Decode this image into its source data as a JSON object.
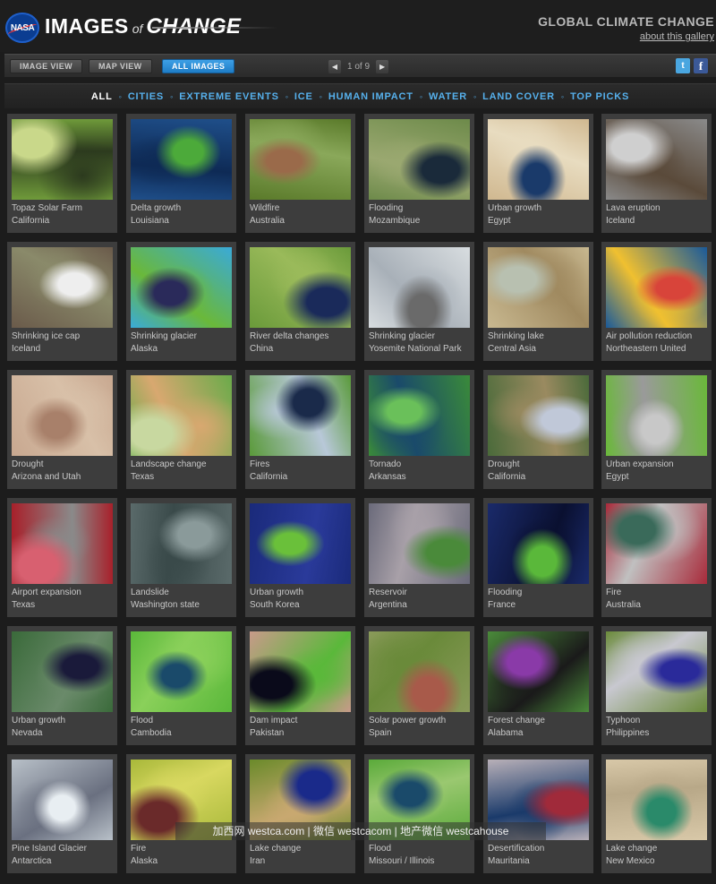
{
  "header": {
    "logo_text": "NASA",
    "brand_part1": "IMAGES",
    "brand_part2": "of",
    "brand_part3": "CHANGE",
    "site_title": "GLOBAL CLIMATE CHANGE",
    "about_link": "about this gallery"
  },
  "toolbar": {
    "image_view": "IMAGE VIEW",
    "map_view": "MAP VIEW",
    "all_images": "ALL IMAGES",
    "page_indicator": "1 of 9",
    "prev_icon": "chevron-left-icon",
    "next_icon": "chevron-right-icon",
    "twitter_icon": "twitter-icon",
    "facebook_icon": "facebook-icon",
    "facebook_glyph": "f",
    "twitter_glyph": "t"
  },
  "categories": [
    "ALL",
    "CITIES",
    "EXTREME EVENTS",
    "ICE",
    "HUMAN IMPACT",
    "WATER",
    "LAND COVER",
    "TOP PICKS"
  ],
  "tiles": [
    {
      "title": "Topaz Solar Farm",
      "location": "California",
      "colors": [
        "#6f9a3a",
        "#c9d88a",
        "#2c3a1e"
      ]
    },
    {
      "title": "Delta growth",
      "location": "Louisiana",
      "colors": [
        "#1f4f8a",
        "#4caa3a",
        "#0e2a55"
      ]
    },
    {
      "title": "Wildfire",
      "location": "Australia",
      "colors": [
        "#5a7a2a",
        "#9a6a4a",
        "#8aa85a"
      ]
    },
    {
      "title": "Flooding",
      "location": "Mozambique",
      "colors": [
        "#6d8a4a",
        "#1a2a3a",
        "#9aa870"
      ]
    },
    {
      "title": "Urban growth",
      "location": "Egypt",
      "colors": [
        "#d0b890",
        "#1a3a6a",
        "#e8dcc0"
      ]
    },
    {
      "title": "Lava eruption",
      "location": "Iceland",
      "colors": [
        "#8a8a8a",
        "#cfcfcf",
        "#5a4a3a"
      ]
    },
    {
      "title": "Shrinking ice cap",
      "location": "Iceland",
      "colors": [
        "#6a5a4a",
        "#eeeeee",
        "#8a8a6a"
      ]
    },
    {
      "title": "Shrinking glacier",
      "location": "Alaska",
      "colors": [
        "#3aaad8",
        "#2a2a5a",
        "#6ab83a"
      ]
    },
    {
      "title": "River delta changes",
      "location": "China",
      "colors": [
        "#6a9a3a",
        "#1a2a5a",
        "#9aba5a"
      ]
    },
    {
      "title": "Shrinking glacier",
      "location": "Yosemite National Park",
      "colors": [
        "#d8dde0",
        "#6a6a6a",
        "#a8b0b8"
      ]
    },
    {
      "title": "Shrinking lake",
      "location": "Central Asia",
      "colors": [
        "#c8b890",
        "#b8c0b0",
        "#a08a60"
      ]
    },
    {
      "title": "Air pollution reduction",
      "location": "Northeastern United",
      "colors": [
        "#1a5a9a",
        "#d8443a",
        "#f0c030"
      ]
    },
    {
      "title": "Drought",
      "location": "Arizona and Utah",
      "colors": [
        "#c8a890",
        "#a8806a",
        "#d8c0a8"
      ]
    },
    {
      "title": "Landscape change",
      "location": "Texas",
      "colors": [
        "#6aaa4a",
        "#c8d8a0",
        "#d8a870"
      ]
    },
    {
      "title": "Fires",
      "location": "California",
      "colors": [
        "#5a9a3a",
        "#1a2a4a",
        "#b8c8d8"
      ]
    },
    {
      "title": "Tornado",
      "location": "Arkansas",
      "colors": [
        "#3a8a3a",
        "#6ac05a",
        "#1a4a6a"
      ]
    },
    {
      "title": "Drought",
      "location": "California",
      "colors": [
        "#4a6a3a",
        "#c0c8d8",
        "#9a8a60"
      ]
    },
    {
      "title": "Urban expansion",
      "location": "Egypt",
      "colors": [
        "#6ab83a",
        "#c8c8c8",
        "#9a9a9a"
      ]
    },
    {
      "title": "Airport expansion",
      "location": "Texas",
      "colors": [
        "#a8202a",
        "#d86070",
        "#8a8a8a"
      ]
    },
    {
      "title": "Landslide",
      "location": "Washington state",
      "colors": [
        "#5a6a6a",
        "#8a9a9a",
        "#3a4a4a"
      ]
    },
    {
      "title": "Urban growth",
      "location": "South Korea",
      "colors": [
        "#1a2a7a",
        "#6ac03a",
        "#2a3a9a"
      ]
    },
    {
      "title": "Reservoir",
      "location": "Argentina",
      "colors": [
        "#6a6a7a",
        "#4a8a3a",
        "#a8a0a8"
      ]
    },
    {
      "title": "Flooding",
      "location": "France",
      "colors": [
        "#1a2a6a",
        "#5ab83a",
        "#0a1030"
      ]
    },
    {
      "title": "Fire",
      "location": "Australia",
      "colors": [
        "#a82a3a",
        "#3a6a5a",
        "#c0c0c0"
      ]
    },
    {
      "title": "Urban growth",
      "location": "Nevada",
      "colors": [
        "#3a6a3a",
        "#1a1a3a",
        "#6a8a6a"
      ]
    },
    {
      "title": "Flood",
      "location": "Cambodia",
      "colors": [
        "#5ab83a",
        "#1a4a6a",
        "#8ad05a"
      ]
    },
    {
      "title": "Dam impact",
      "location": "Pakistan",
      "colors": [
        "#c89a8a",
        "#0a0a1a",
        "#5ab83a"
      ]
    },
    {
      "title": "Solar power growth",
      "location": "Spain",
      "colors": [
        "#8a9a5a",
        "#a85a4a",
        "#6a8a3a"
      ]
    },
    {
      "title": "Forest change",
      "location": "Alabama",
      "colors": [
        "#4a8a3a",
        "#8a3aa8",
        "#1a1a1a"
      ]
    },
    {
      "title": "Typhoon",
      "location": "Philippines",
      "colors": [
        "#6a8a3a",
        "#2a2a9a",
        "#c8c8d0"
      ]
    },
    {
      "title": "Pine Island Glacier",
      "location": "Antarctica",
      "colors": [
        "#b8c0c8",
        "#e8eef2",
        "#6a7080"
      ]
    },
    {
      "title": "Fire",
      "location": "Alaska",
      "colors": [
        "#a8b83a",
        "#6a2a2a",
        "#d8d860"
      ]
    },
    {
      "title": "Lake change",
      "location": "Iran",
      "colors": [
        "#6a8a2a",
        "#1a2a8a",
        "#c8a870"
      ]
    },
    {
      "title": "Flood",
      "location": "Missouri / Illinois",
      "colors": [
        "#5aaa3a",
        "#1a4a6a",
        "#9ac870"
      ]
    },
    {
      "title": "Desertification",
      "location": "Mauritania",
      "colors": [
        "#b8b0b8",
        "#a02a3a",
        "#1a3a6a"
      ]
    },
    {
      "title": "Lake change",
      "location": "New Mexico",
      "colors": [
        "#d8c8a8",
        "#2a8a6a",
        "#b8a888"
      ]
    }
  ],
  "watermark": "加西网 westca.com | 微信 westcacom | 地产微信 westcahouse"
}
